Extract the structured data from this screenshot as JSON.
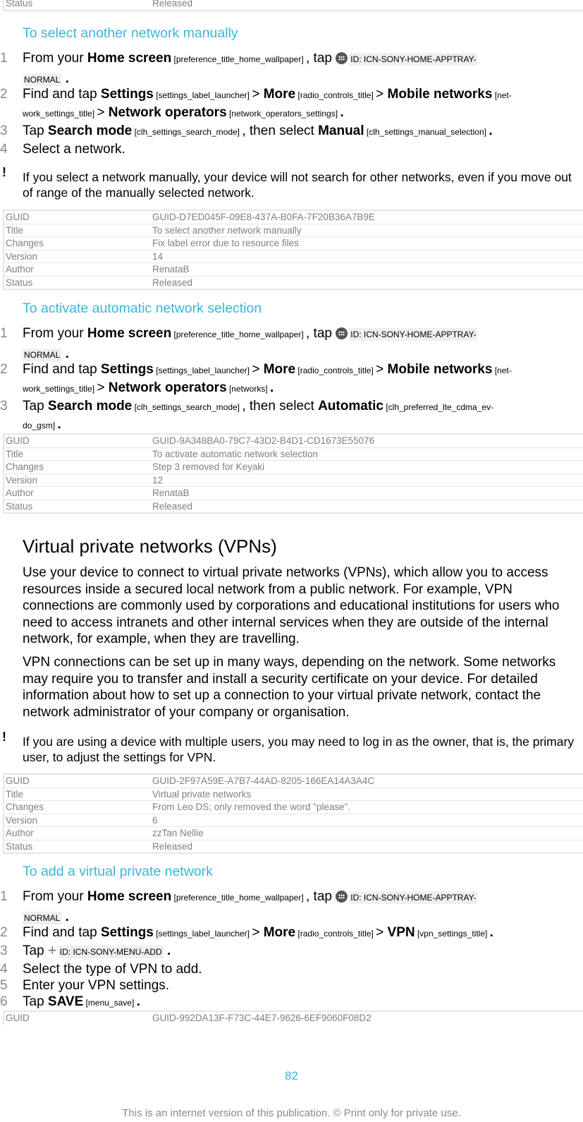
{
  "top_table_tail": {
    "key": "Status",
    "value": "Released"
  },
  "section1": {
    "title": "To select another network manually",
    "steps": [
      {
        "num": "1",
        "parts": {
          "a": "From your ",
          "b": "Home screen",
          "c": " [preference_title_home_wallpaper] ",
          "d": ", tap ",
          "icon_id_1": "ID: ICN-SONY-HOME-APPTRAY-",
          "icon_id_2": "NORMAL",
          "end": " ."
        }
      },
      {
        "num": "2",
        "parts": {
          "a": "Find and tap ",
          "b": "Settings",
          "c": " [settings_label_launcher] ",
          "d": "> ",
          "e": "More",
          "f": " [radio_controls_title] ",
          "g": "> ",
          "h": "Mobile networks",
          "i": " [net-",
          "j": "work_settings_title] ",
          "k": "> ",
          "l": "Network operators",
          "m": " [network_operators_settings] ",
          "end": "."
        }
      },
      {
        "num": "3",
        "parts": {
          "a": "Tap ",
          "b": "Search mode",
          "c": " [clh_settings_search_mode] ",
          "d": ", then select ",
          "e": "Manual",
          "f": " [clh_settings_manual_selection] ",
          "end": "."
        }
      },
      {
        "num": "4",
        "text": "Select a network."
      }
    ],
    "note": "If you select a network manually, your device will not search for other networks, even if you move out of range of the manually selected network.",
    "meta": [
      {
        "key": "GUID",
        "value": "GUID-D7ED045F-09E8-437A-B0FA-7F20B36A7B9E"
      },
      {
        "key": "Title",
        "value": "To select another network manually"
      },
      {
        "key": "Changes",
        "value": "Fix label error due to resource files"
      },
      {
        "key": "Version",
        "value": "14"
      },
      {
        "key": "Author",
        "value": "RenataB"
      },
      {
        "key": "Status",
        "value": "Released"
      }
    ]
  },
  "section2": {
    "title": "To activate automatic network selection",
    "steps": [
      {
        "num": "1",
        "parts": {
          "a": "From your ",
          "b": "Home screen",
          "c": " [preference_title_home_wallpaper] ",
          "d": ", tap ",
          "icon_id_1": "ID: ICN-SONY-HOME-APPTRAY-",
          "icon_id_2": "NORMAL",
          "end": " ."
        }
      },
      {
        "num": "2",
        "parts": {
          "a": "Find and tap ",
          "b": "Settings",
          "c": " [settings_label_launcher] ",
          "d": "> ",
          "e": "More",
          "f": " [radio_controls_title] ",
          "g": "> ",
          "h": "Mobile networks",
          "i": " [net-",
          "j": "work_settings_title] ",
          "k": "> ",
          "l": "Network operators",
          "m": " [networks] ",
          "end": "."
        }
      },
      {
        "num": "3",
        "parts": {
          "a": "Tap ",
          "b": "Search mode",
          "c": " [clh_settings_search_mode] ",
          "d": ", then select ",
          "e": "Automatic",
          "f": " [clh_preferred_lte_cdma_ev-",
          "g": "do_gsm] ",
          "end": "."
        }
      }
    ],
    "meta": [
      {
        "key": "GUID",
        "value": "GUID-9A348BA0-79C7-43D2-B4D1-CD1673E55076"
      },
      {
        "key": "Title",
        "value": "To activate automatic network selection"
      },
      {
        "key": "Changes",
        "value": "Step 3 removed for Keyaki"
      },
      {
        "key": "Version",
        "value": "12"
      },
      {
        "key": "Author",
        "value": "RenataB"
      },
      {
        "key": "Status",
        "value": "Released"
      }
    ]
  },
  "vpn": {
    "heading": "Virtual private networks (VPNs)",
    "para1": "Use your device to connect to virtual private networks (VPNs), which allow you to access resources inside a secured local network from a public network. For example, VPN connections are commonly used by corporations and educational institutions for users who need to access intranets and other internal services when they are outside of the internal network, for example, when they are travelling.",
    "para2": "VPN connections can be set up in many ways, depending on the network. Some networks may require you to transfer and install a security certificate on your device. For detailed information about how to set up a connection to your virtual private network, contact the network administrator of your company or organisation.",
    "note": "If you are using a device with multiple users, you may need to log in as the owner, that is, the primary user, to adjust the settings for VPN.",
    "meta": [
      {
        "key": "GUID",
        "value": "GUID-2F97A59E-A7B7-44AD-8205-166EA14A3A4C"
      },
      {
        "key": "Title",
        "value": "Virtual private networks"
      },
      {
        "key": "Changes",
        "value": "From Leo DS; only removed the word \"please\"."
      },
      {
        "key": "Version",
        "value": "6"
      },
      {
        "key": "Author",
        "value": "zzTan Nellie"
      },
      {
        "key": "Status",
        "value": "Released"
      }
    ]
  },
  "section3": {
    "title": "To add a virtual private network",
    "steps": [
      {
        "num": "1",
        "parts": {
          "a": "From your ",
          "b": "Home screen",
          "c": " [preference_title_home_wallpaper] ",
          "d": ", tap ",
          "icon_id_1": "ID: ICN-SONY-HOME-APPTRAY-",
          "icon_id_2": "NORMAL",
          "end": " ."
        }
      },
      {
        "num": "2",
        "parts": {
          "a": "Find and tap ",
          "b": "Settings",
          "c": " [settings_label_launcher] ",
          "d": "> ",
          "e": "More",
          "f": " [radio_controls_title] ",
          "g": "> ",
          "h": "VPN",
          "i": " [vpn_settings_title] ",
          "end": "."
        }
      },
      {
        "num": "3",
        "parts": {
          "a": "Tap ",
          "icon_id": "ID: ICN-SONY-MENU-ADD",
          "end": " ."
        }
      },
      {
        "num": "4",
        "text": "Select the type of VPN to add."
      },
      {
        "num": "5",
        "text": "Enter your VPN settings."
      },
      {
        "num": "6",
        "parts": {
          "a": "Tap ",
          "b": "SAVE",
          "c": " [menu_save] ",
          "end": "."
        }
      }
    ],
    "meta": [
      {
        "key": "GUID",
        "value": "GUID-992DA13F-F73C-44E7-9626-6EF9060F08D2"
      }
    ]
  },
  "footer": {
    "page_number": "82",
    "notice": "This is an internet version of this publication. © Print only for private use."
  }
}
